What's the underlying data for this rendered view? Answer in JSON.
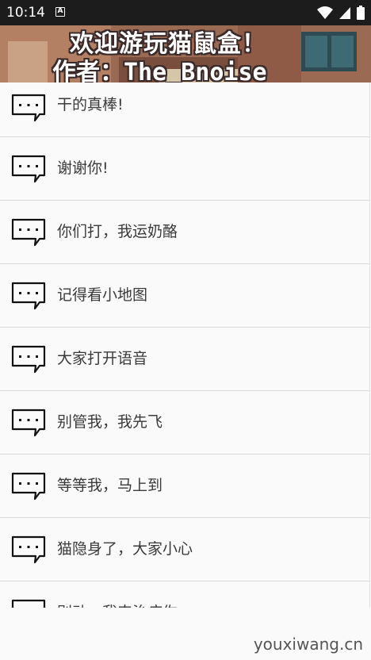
{
  "status_bar": {
    "time": "10:14",
    "notification_icon_letter": "A",
    "icons": [
      "notification-a-icon",
      "wifi-icon",
      "cell-signal-icon",
      "battery-icon"
    ]
  },
  "banner": {
    "line1": "欢迎游玩猫鼠盒！",
    "line2": "作者：The_Bnoise"
  },
  "phrases": [
    "干的真棒!",
    "谢谢你!",
    "你们打，我运奶酪",
    "记得看小地图",
    "大家打开语音",
    "别管我，我先飞",
    "等等我，马上到",
    "猫隐身了，大家小心",
    "别动，我来治疗你"
  ],
  "watermark": "youxiwang.cn",
  "colors": {
    "status_bar": "#1c1c1c",
    "background": "#fafafa",
    "text": "#3a3a3a",
    "divider": "#dcdcdc"
  }
}
